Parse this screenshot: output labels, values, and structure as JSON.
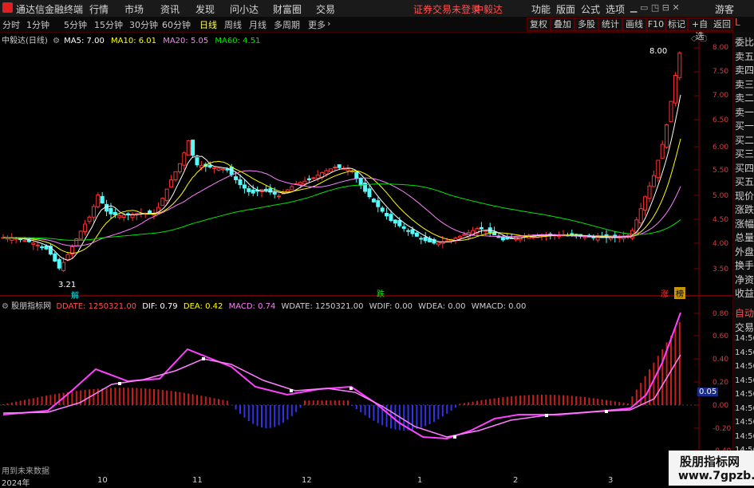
{
  "titlebar": {
    "app_name": "通达信金融终端",
    "menu": [
      "行情",
      "市场",
      "资讯",
      "发现",
      "问小达",
      "财富圈",
      "交易"
    ],
    "notice": "证券交易未登录",
    "stock": "中毅达",
    "right_menu": [
      "功能",
      "版面",
      "公式",
      "选项"
    ],
    "guest": "游客"
  },
  "toolbar": {
    "periods": [
      "分时",
      "1分钟",
      "5分钟",
      "15分钟",
      "30分钟",
      "60分钟",
      "日线",
      "周线",
      "月线",
      "多周期",
      "更多"
    ],
    "active_period": "日线",
    "right_buttons": [
      "复权",
      "叠加",
      "多股",
      "统计",
      "画线",
      "F10",
      "标记",
      "+自选",
      "返回"
    ]
  },
  "main_chart": {
    "title": "中毅达(日线)",
    "ma5": "MA5: 7.00",
    "ma10": "MA10: 6.01",
    "ma20": "MA20: 5.05",
    "ma60": "MA60: 4.51",
    "high_label": "8.00",
    "low_label": "3.21",
    "badge_jie": "解",
    "badge_die": "跌",
    "badge_zhang": "涨",
    "badge_bang": "榜",
    "y_ticks": [
      "8.00",
      "7.50",
      "7.00",
      "6.50",
      "6.00",
      "5.50",
      "5.00",
      "4.50",
      "4.00",
      "3.50"
    ]
  },
  "indicator": {
    "title": "股朋指标网",
    "ddate": "DDATE: 1250321.00",
    "dif": "DIF: 0.79",
    "dea": "DEA: 0.42",
    "macd": "MACD: 0.74",
    "wdate": "WDATE: 1250321.00",
    "wdif": "WDIF: 0.00",
    "wdea": "WDEA: 0.00",
    "wmacd": "WMACD: 0.00",
    "y_ticks": [
      "0.80",
      "0.60",
      "0.40",
      "0.20",
      "0.00",
      "-0.20",
      "-0.40"
    ],
    "marker": "0.05",
    "footer": "用到未来数据"
  },
  "right_panel": {
    "items_top": [
      "委比",
      "卖五",
      "卖四",
      "卖三",
      "卖二",
      "卖一",
      "买一",
      "买二",
      "买三",
      "买四",
      "买五",
      "现价",
      "涨跌",
      "涨幅",
      "总量",
      "外盘",
      "换手",
      "净资",
      "收益"
    ],
    "items_bottom": [
      "自动",
      "交易",
      "14:56",
      "14:56",
      "14:56",
      "14:56",
      "14:56",
      "14:56",
      "14:56",
      "14:56",
      "14:56",
      "14:56"
    ],
    "corner": "L"
  },
  "x_axis": [
    "2024年",
    "10",
    "11",
    "12",
    "1",
    "2",
    "3"
  ],
  "watermark": {
    "line1": "股朋指标网",
    "line2": "www.7gpzb.com"
  },
  "colors": {
    "up": "#ff3232",
    "down": "#54fcfc",
    "ma5": "#ffffff",
    "ma10": "#ffff00",
    "ma20": "#ff80ff",
    "ma60": "#00e600"
  }
}
